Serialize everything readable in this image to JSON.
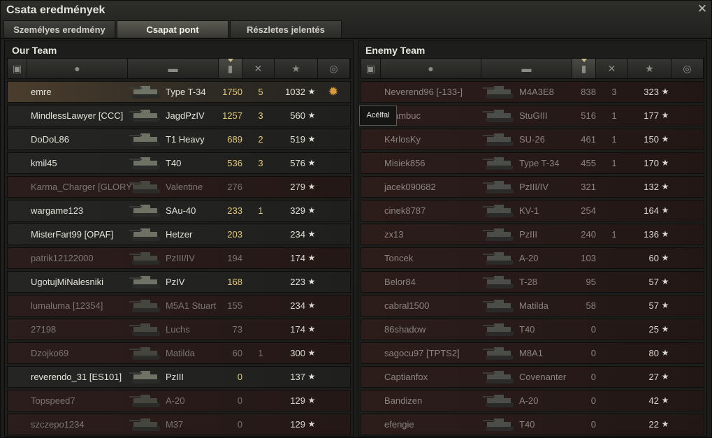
{
  "window": {
    "title": "Csata eredmények",
    "close_icon": "close-icon"
  },
  "tabs": [
    {
      "label": "Személyes eredmény",
      "active": false
    },
    {
      "label": "Csapat pont",
      "active": true
    },
    {
      "label": "Részletes jelentés",
      "active": false
    }
  ],
  "columns": {
    "icons": [
      "squad-icon",
      "player-icon",
      "tank-icon",
      "xp-icon",
      "kills-icon",
      "star-icon",
      "medal-icon"
    ],
    "sorted": "xp-icon"
  },
  "our_team": {
    "title": "Our Team",
    "players": [
      {
        "name": "emre",
        "tank": "Type T-34",
        "xp": "1750",
        "kills": "5",
        "score": "1032",
        "status": "me",
        "medal": true
      },
      {
        "name": "MindlessLawyer [CCC]",
        "tank": "JagdPzIV",
        "xp": "1257",
        "kills": "3",
        "score": "560",
        "status": "alive"
      },
      {
        "name": "DoDoL86",
        "tank": "T1 Heavy",
        "xp": "689",
        "kills": "2",
        "score": "519",
        "status": "alive"
      },
      {
        "name": "kmil45",
        "tank": "T40",
        "xp": "536",
        "kills": "3",
        "score": "576",
        "status": "alive"
      },
      {
        "name": "Karma_Charger [GLORY]",
        "tank": "Valentine",
        "xp": "276",
        "kills": "",
        "score": "279",
        "status": "dead"
      },
      {
        "name": "wargame123",
        "tank": "SAu-40",
        "xp": "233",
        "kills": "1",
        "score": "329",
        "status": "alive"
      },
      {
        "name": "MisterFart99 [OPAF]",
        "tank": "Hetzer",
        "xp": "203",
        "kills": "",
        "score": "234",
        "status": "alive"
      },
      {
        "name": "patrik12122000",
        "tank": "PzIII/IV",
        "xp": "194",
        "kills": "",
        "score": "174",
        "status": "dead"
      },
      {
        "name": "UgotujMiNalesniki",
        "tank": "PzIV",
        "xp": "168",
        "kills": "",
        "score": "223",
        "status": "alive"
      },
      {
        "name": "lumaluma [12354]",
        "tank": "M5A1 Stuart",
        "xp": "155",
        "kills": "",
        "score": "234",
        "status": "dead"
      },
      {
        "name": "27198",
        "tank": "Luchs",
        "xp": "73",
        "kills": "",
        "score": "174",
        "status": "dead"
      },
      {
        "name": "Dzojko69",
        "tank": "Matilda",
        "xp": "60",
        "kills": "1",
        "score": "300",
        "status": "dead"
      },
      {
        "name": "reverendo_31 [ES101]",
        "tank": "PzIII",
        "xp": "0",
        "kills": "",
        "score": "137",
        "status": "alive"
      },
      {
        "name": "Topspeed7",
        "tank": "A-20",
        "xp": "0",
        "kills": "",
        "score": "129",
        "status": "dead"
      },
      {
        "name": "szczepo1234",
        "tank": "M37",
        "xp": "0",
        "kills": "",
        "score": "129",
        "status": "dead"
      }
    ]
  },
  "enemy_team": {
    "title": "Enemy Team",
    "players": [
      {
        "name": "Neverend96 [-133-]",
        "tank": "M4A3E8",
        "xp": "838",
        "kills": "3",
        "score": "323"
      },
      {
        "name": "Brambuc",
        "tank": "StuGIII",
        "xp": "516",
        "kills": "1",
        "score": "177"
      },
      {
        "name": "K4rlosKy",
        "tank": "SU-26",
        "xp": "461",
        "kills": "1",
        "score": "150"
      },
      {
        "name": "Misiek856",
        "tank": "Type T-34",
        "xp": "455",
        "kills": "1",
        "score": "170"
      },
      {
        "name": "jacek090682",
        "tank": "PzIII/IV",
        "xp": "321",
        "kills": "",
        "score": "132"
      },
      {
        "name": "cinek8787",
        "tank": "KV-1",
        "xp": "254",
        "kills": "",
        "score": "164"
      },
      {
        "name": "zx13",
        "tank": "PzIII",
        "xp": "240",
        "kills": "1",
        "score": "136"
      },
      {
        "name": "Toncek",
        "tank": "A-20",
        "xp": "103",
        "kills": "",
        "score": "60"
      },
      {
        "name": "Belor84",
        "tank": "T-28",
        "xp": "95",
        "kills": "",
        "score": "57"
      },
      {
        "name": "cabral1500",
        "tank": "Matilda",
        "xp": "58",
        "kills": "",
        "score": "57"
      },
      {
        "name": "86shadow",
        "tank": "T40",
        "xp": "0",
        "kills": "",
        "score": "25"
      },
      {
        "name": "sagocu97 [TPTS2]",
        "tank": "M8A1",
        "xp": "0",
        "kills": "",
        "score": "80"
      },
      {
        "name": "Captianfox",
        "tank": "Covenanter",
        "xp": "0",
        "kills": "",
        "score": "27"
      },
      {
        "name": "Bandizen",
        "tank": "A-20",
        "xp": "0",
        "kills": "",
        "score": "42"
      },
      {
        "name": "efengie",
        "tank": "T40",
        "xp": "0",
        "kills": "",
        "score": "22"
      }
    ]
  },
  "tooltip": {
    "text": "Acélfal"
  },
  "star_glyph": "★"
}
